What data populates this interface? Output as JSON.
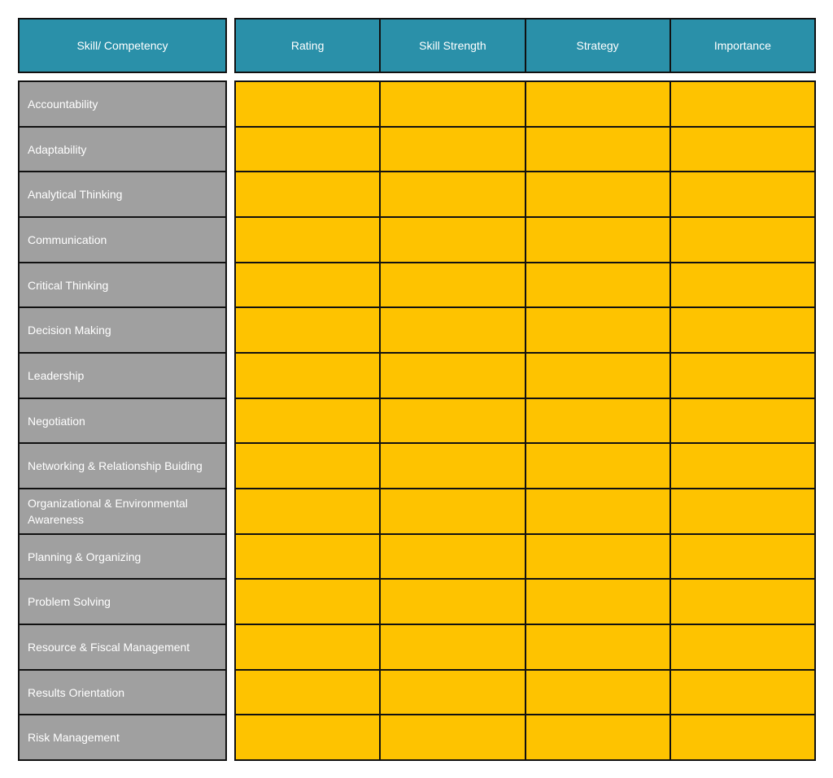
{
  "header": {
    "skill_label": "Skill/ Competency",
    "columns": [
      "Rating",
      "Skill Strength",
      "Strategy",
      "Importance"
    ]
  },
  "colors": {
    "header": "#2a90a9",
    "label": "#a0a0a0",
    "cell": "#fec300",
    "border": "#111111"
  },
  "rows": [
    {
      "skill": "Accountability"
    },
    {
      "skill": "Adaptability"
    },
    {
      "skill": "Analytical Thinking"
    },
    {
      "skill": "Communication"
    },
    {
      "skill": "Critical Thinking"
    },
    {
      "skill": "Decision Making"
    },
    {
      "skill": "Leadership"
    },
    {
      "skill": "Negotiation"
    },
    {
      "skill": "Networking & Relationship Buiding"
    },
    {
      "skill": "Organizational & Environmental Awareness"
    },
    {
      "skill": "Planning & Organizing"
    },
    {
      "skill": "Problem Solving"
    },
    {
      "skill": "Resource & Fiscal Management"
    },
    {
      "skill": "Results Orientation"
    },
    {
      "skill": "Risk Management"
    }
  ]
}
